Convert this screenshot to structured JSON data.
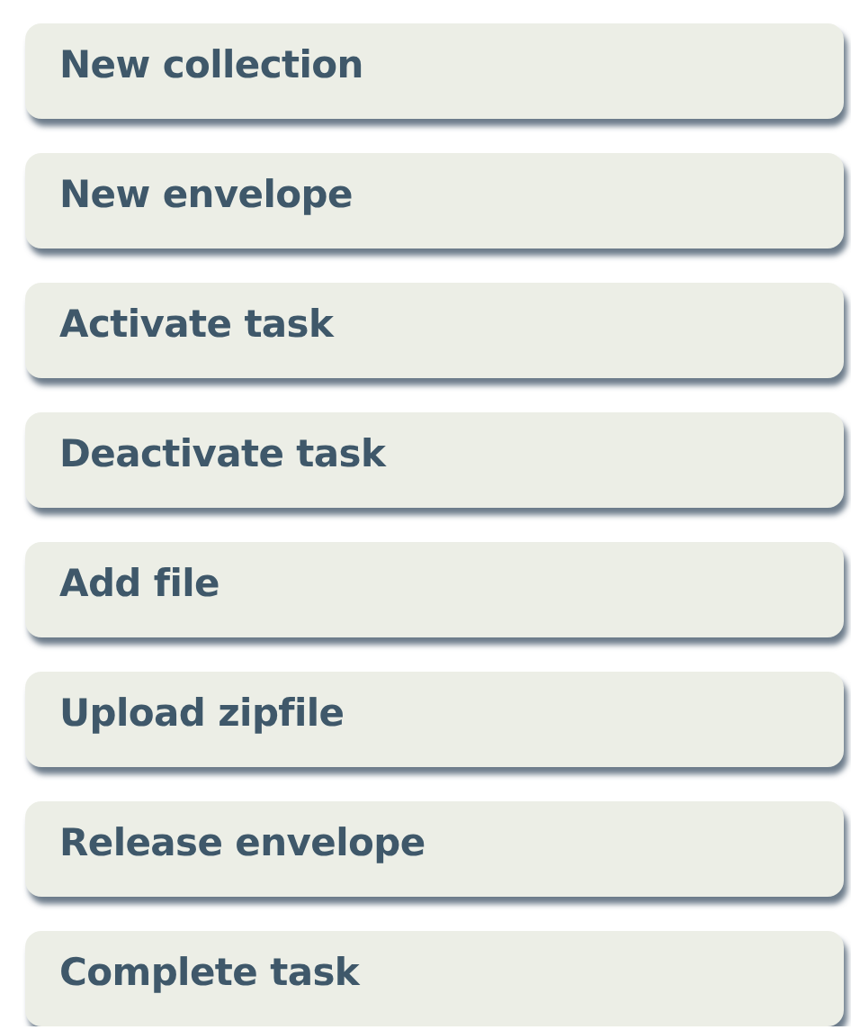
{
  "buttons": [
    {
      "label": "New collection"
    },
    {
      "label": "New envelope"
    },
    {
      "label": "Activate task"
    },
    {
      "label": "Deactivate task"
    },
    {
      "label": "Add file"
    },
    {
      "label": "Upload zipfile"
    },
    {
      "label": "Release envelope"
    },
    {
      "label": "Complete task"
    }
  ]
}
